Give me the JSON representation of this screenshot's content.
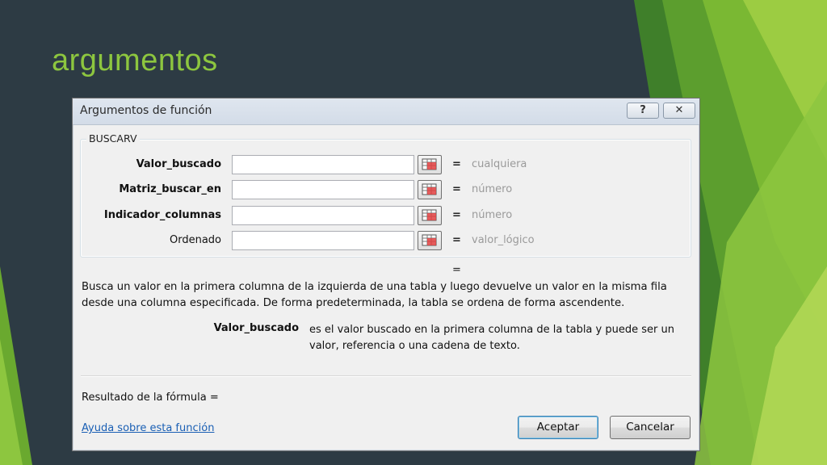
{
  "slide": {
    "title": "argumentos"
  },
  "dialog": {
    "title": "Argumentos de función",
    "help_symbol": "?",
    "close_symbol": "✕",
    "function_name": "BUSCARV",
    "arguments": [
      {
        "label": "Valor_buscado",
        "bold": true,
        "value": "",
        "hint": "cualquiera"
      },
      {
        "label": "Matriz_buscar_en",
        "bold": true,
        "value": "",
        "hint": "número"
      },
      {
        "label": "Indicador_columnas",
        "bold": true,
        "value": "",
        "hint": "número"
      },
      {
        "label": "Ordenado",
        "bold": false,
        "value": "",
        "hint": "valor_lógico"
      }
    ],
    "equals_sign": "=",
    "description": "Busca un valor en la primera columna de la izquierda de una tabla y luego devuelve un valor en la misma fila desde una columna especificada. De forma predeterminada, la tabla se ordena de forma ascendente.",
    "param_name": "Valor_buscado",
    "param_description": "es el valor buscado en la primera columna de la tabla y puede ser un valor, referencia o una cadena de texto.",
    "result_label": "Resultado de la fórmula =",
    "help_link": "Ayuda sobre esta función",
    "ok_label": "Aceptar",
    "cancel_label": "Cancelar"
  },
  "colors": {
    "background": "#2d3b44",
    "title_green": "#8dc63f",
    "link_blue": "#1a5fb4"
  }
}
